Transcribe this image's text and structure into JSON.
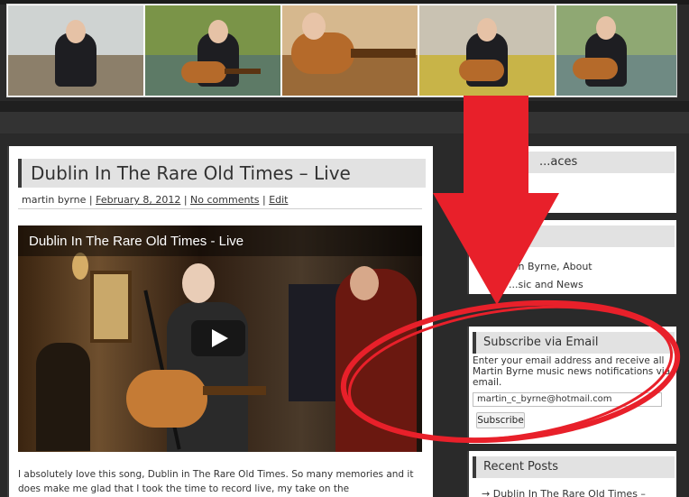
{
  "post": {
    "title": "Dublin In The Rare Old Times – Live",
    "author": "martin byrne",
    "date": "February 8, 2012",
    "comments": "No comments",
    "edit": "Edit",
    "video_title": "Dublin In The Rare Old Times - Live",
    "body_text": "I absolutely love this song, Dublin in The Rare Old Times. So many memories and it does make me glad that I took the time to record live, my take on the"
  },
  "sidebar": {
    "places_title": "...aces",
    "pages_links": [
      "...n Byrne, About",
      "...sic and News"
    ],
    "subscribe": {
      "title": "Subscribe via Email",
      "description": "Enter your email address and receive all Martin Byrne music news notifications via email.",
      "email_value": "martin_c_byrne@hotmail.com",
      "button_label": "Subscribe"
    },
    "recent_posts": {
      "title": "Recent Posts",
      "first_item": "Dublin In The Rare Old Times –"
    }
  },
  "colors": {
    "annotation_red": "#e8202a",
    "page_dark": "#2a2a2a",
    "title_bar": "#e2e2e2"
  }
}
